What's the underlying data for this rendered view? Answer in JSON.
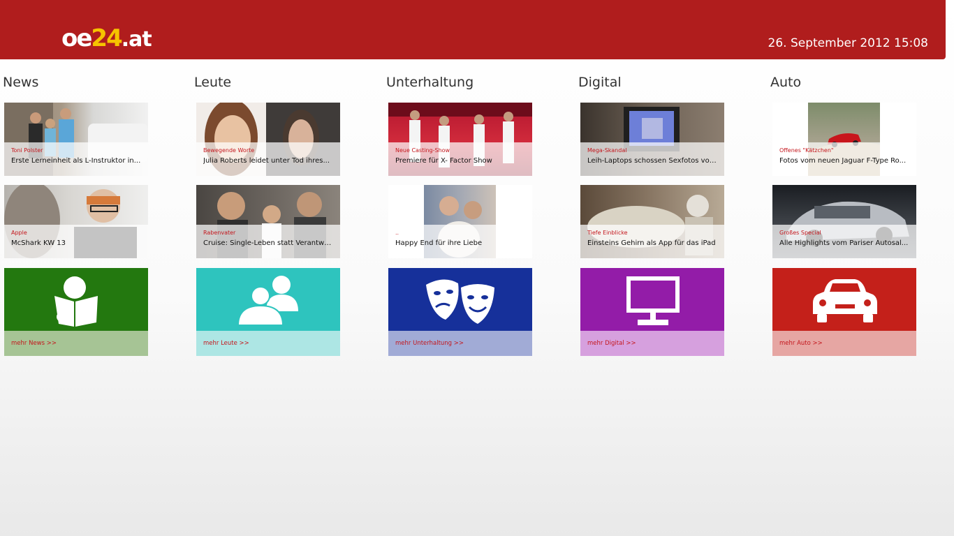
{
  "header": {
    "logo": {
      "oe": "oe",
      "num": "24",
      "tld": ".at"
    },
    "datetime": "26. September 2012 15:08"
  },
  "sections": [
    {
      "title": "News",
      "articles": [
        {
          "kicker": "Toni Polster",
          "headline": "Erste Lerneinheit als L-Instruktor in..."
        },
        {
          "kicker": "Apple",
          "headline": "McShark KW 13"
        }
      ],
      "more": "mehr News >>",
      "icon": "newspaper-reader-icon"
    },
    {
      "title": "Leute",
      "articles": [
        {
          "kicker": "Bewegende Worte",
          "headline": "Julia Roberts leidet unter Tod ihres..."
        },
        {
          "kicker": "Rabenvater",
          "headline": "Cruise: Single-Leben statt Verantwo..."
        }
      ],
      "more": "mehr Leute >>",
      "icon": "people-icon"
    },
    {
      "title": "Unterhaltung",
      "articles": [
        {
          "kicker": "Neue Casting-Show",
          "headline": "Premiere für X- Factor Show"
        },
        {
          "kicker": "..",
          "headline": "Happy End für ihre Liebe"
        }
      ],
      "more": "mehr Unterhaltung >>",
      "icon": "theater-masks-icon"
    },
    {
      "title": "Digital",
      "articles": [
        {
          "kicker": "Mega-Skandal",
          "headline": "Leih-Laptops schossen Sexfotos von..."
        },
        {
          "kicker": "Tiefe Einblicke",
          "headline": "Einsteins Gehirn als App für das iPad"
        }
      ],
      "more": "mehr Digital >>",
      "icon": "monitor-icon"
    },
    {
      "title": "Auto",
      "articles": [
        {
          "kicker": "Offenes \"Kätzchen\"",
          "headline": "Fotos vom neuen Jaguar F-Type Ro..."
        },
        {
          "kicker": "Großes Special",
          "headline": "Alle Highlights vom Pariser Autosal..."
        }
      ],
      "more": "mehr Auto >>",
      "icon": "car-icon"
    }
  ],
  "colors": {
    "header": "#b01d1d",
    "kicker": "#c4161c",
    "news": [
      "#23780f",
      "#a6c495"
    ],
    "leute": [
      "#2ec4be",
      "#ade6e4"
    ],
    "unterhaltung": [
      "#16309a",
      "#a1abd6"
    ],
    "digital": [
      "#931ca8",
      "#d6a0de"
    ],
    "auto": [
      "#c4201a",
      "#e6a6a3"
    ]
  }
}
